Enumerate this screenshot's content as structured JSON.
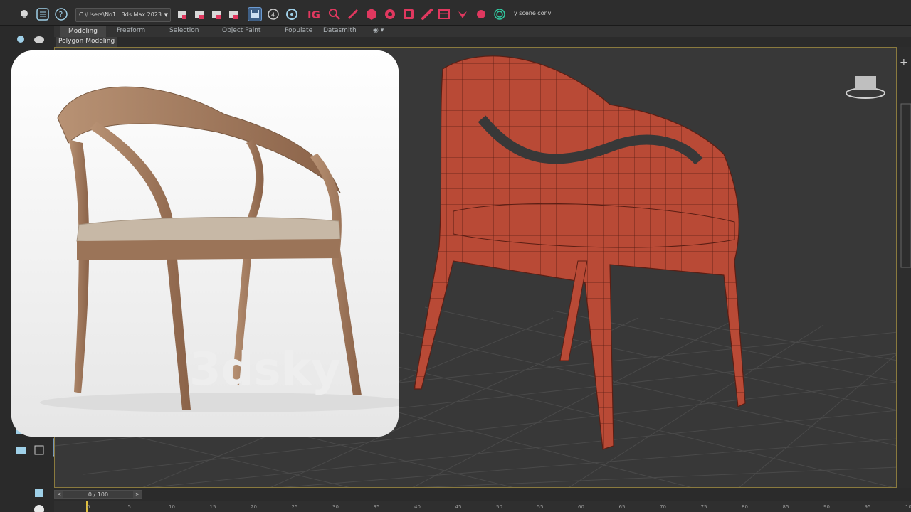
{
  "toolbar": {
    "file_path": "C:\\Users\\No1...3ds Max 2023",
    "scene_text": "y scene conv",
    "icons": [
      "bulb-icon",
      "list-icon",
      "help-icon",
      "link-icon",
      "unlink-icon",
      "bind-icon",
      "group-icon",
      "save-icon",
      "snap-icon",
      "refresh-icon",
      "ig-icon",
      "search-icon",
      "brush-icon",
      "settings-icon",
      "gear-icon",
      "render-icon",
      "chain-icon",
      "frame-icon",
      "heart-icon",
      "star-icon",
      "fingerprint-icon"
    ],
    "accent_color": "#e0385f"
  },
  "ribbon": {
    "tabs": [
      {
        "label": "Modeling",
        "active": true
      },
      {
        "label": "Freeform",
        "active": false
      },
      {
        "label": "Selection",
        "active": false
      },
      {
        "label": "Object Paint",
        "active": false
      },
      {
        "label": "Populate",
        "active": false
      },
      {
        "label": "Datasmith",
        "active": false
      }
    ],
    "sub_label": "Polygon Modeling"
  },
  "viewport": {
    "mesh_color": "#b94a36",
    "grid_color": "#4a4a4a",
    "border_color": "#8a7a3e"
  },
  "reference": {
    "watermark": "3dsky"
  },
  "timeline": {
    "frame_display": "0 / 100",
    "ticks": [
      "0",
      "5",
      "10",
      "15",
      "20",
      "25",
      "30",
      "35",
      "40",
      "45",
      "50",
      "55",
      "60",
      "65",
      "70",
      "75",
      "80",
      "85",
      "90",
      "95",
      "100"
    ]
  }
}
